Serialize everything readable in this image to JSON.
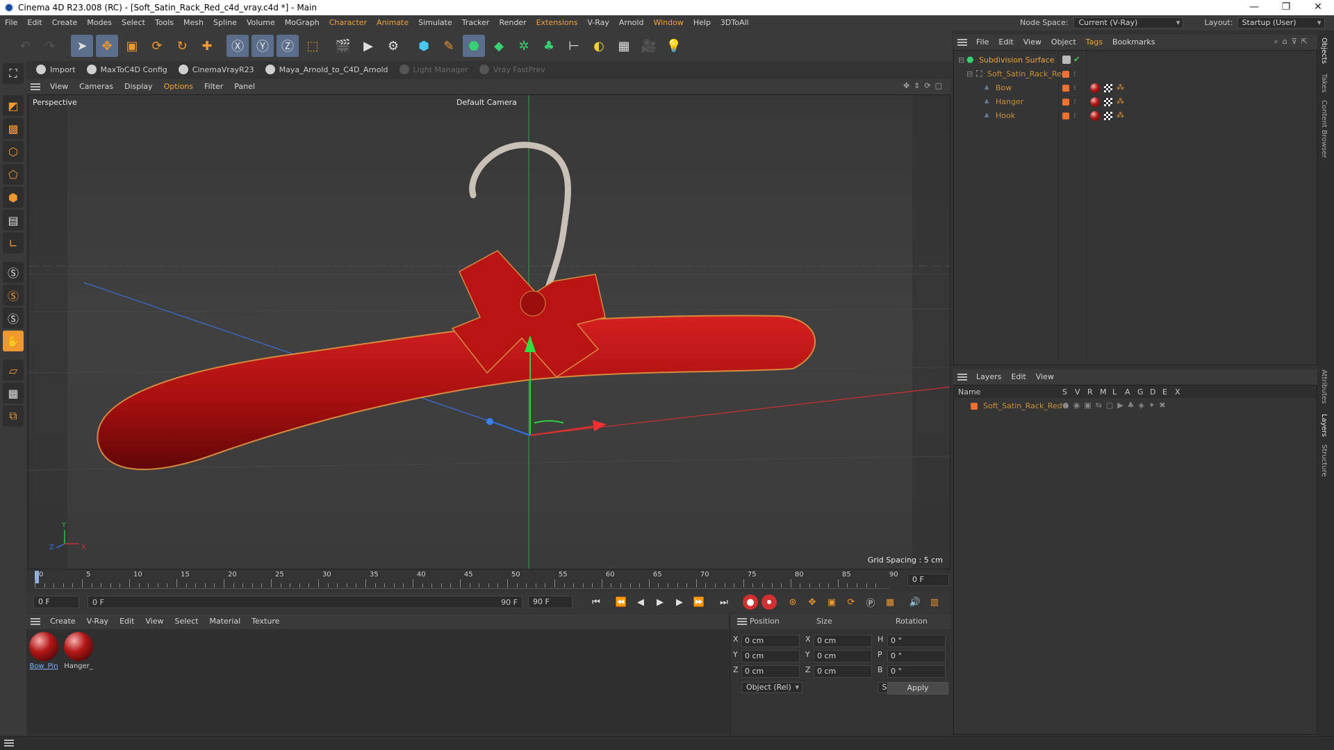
{
  "window": {
    "title": "Cinema 4D R23.008 (RC) - [Soft_Satin_Rack_Red_c4d_vray.c4d *] - Main",
    "controls": [
      "—",
      "❐",
      "✕"
    ]
  },
  "menubar": {
    "items": [
      "File",
      "Edit",
      "Create",
      "Modes",
      "Select",
      "Tools",
      "Mesh",
      "Spline",
      "Volume",
      "MoGraph",
      "Character",
      "Animate",
      "Simulate",
      "Tracker",
      "Render",
      "Extensions",
      "V-Ray",
      "Arnold",
      "Window",
      "Help",
      "3DToAll"
    ],
    "node_space_label": "Node Space:",
    "node_space_value": "Current (V-Ray)",
    "layout_label": "Layout:",
    "layout_value": "Startup (User)"
  },
  "plugins": {
    "items": [
      "Import",
      "MaxToC4D Config",
      "CinemaVrayR23",
      "Maya_Arnold_to_C4D_Arnold",
      "Light Manager",
      "Vray FastPrev"
    ]
  },
  "viewport": {
    "menu": [
      "View",
      "Cameras",
      "Display",
      "Options",
      "Filter",
      "Panel"
    ],
    "label": "Perspective",
    "camera": "Default Camera",
    "grid_spacing": "Grid Spacing : 5 cm",
    "axis_x": "X",
    "axis_y": "Y",
    "axis_z": "Z"
  },
  "timeline": {
    "ticks": [
      "0",
      "5",
      "10",
      "15",
      "20",
      "25",
      "30",
      "35",
      "40",
      "45",
      "50",
      "55",
      "60",
      "65",
      "70",
      "75",
      "80",
      "85",
      "90"
    ],
    "current_frame": "0 F",
    "start_field": "0 F",
    "range_start": "0 F",
    "range_end": "90 F",
    "end_field": "90 F"
  },
  "materials": {
    "menu": [
      "Create",
      "V-Ray",
      "Edit",
      "View",
      "Select",
      "Material",
      "Texture"
    ],
    "items": [
      {
        "label": "Bow_Pin",
        "selected": true
      },
      {
        "label": "Hanger_",
        "selected": false
      }
    ]
  },
  "coordinates": {
    "headers": {
      "position": "Position",
      "size": "Size",
      "rotation": "Rotation"
    },
    "rows": [
      {
        "axis": "X",
        "pos": "0 cm",
        "size_axis": "X",
        "size": "0 cm",
        "rot_axis": "H",
        "rot": "0 °"
      },
      {
        "axis": "Y",
        "pos": "0 cm",
        "size_axis": "Y",
        "size": "0 cm",
        "rot_axis": "P",
        "rot": "0 °"
      },
      {
        "axis": "Z",
        "pos": "0 cm",
        "size_axis": "Z",
        "size": "0 cm",
        "rot_axis": "B",
        "rot": "0 °"
      }
    ],
    "mode": "Object (Rel)",
    "size_mode": "Size",
    "apply": "Apply"
  },
  "objects": {
    "menu": [
      "File",
      "Edit",
      "View",
      "Object",
      "Tags",
      "Bookmarks"
    ],
    "tree": [
      {
        "name": "Subdivision Surface",
        "level": 0
      },
      {
        "name": "Soft_Satin_Rack_Red",
        "level": 1
      },
      {
        "name": "Bow",
        "level": 2
      },
      {
        "name": "Hanger",
        "level": 2
      },
      {
        "name": "Hook",
        "level": 2
      }
    ]
  },
  "layers": {
    "menu": [
      "Layers",
      "Edit",
      "View"
    ],
    "columns": [
      "Name",
      "S",
      "V",
      "R",
      "M",
      "L",
      "A",
      "G",
      "D",
      "E",
      "X"
    ],
    "items": [
      {
        "name": "Soft_Satin_Rack_Red"
      }
    ]
  },
  "side_tabs": [
    "Objects",
    "Takes",
    "Content Browser",
    "Attributes",
    "Layers",
    "Structure"
  ],
  "colors": {
    "accent": "#f0a23c",
    "object_red": "#b01212",
    "selection_blue": "#5b6e8c"
  }
}
